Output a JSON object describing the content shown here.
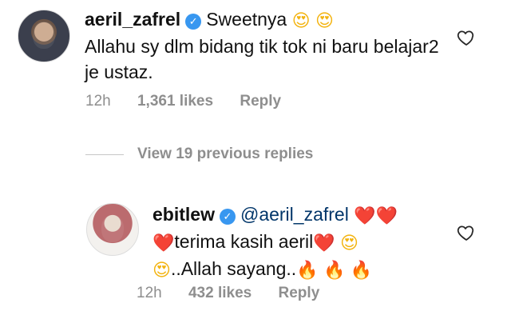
{
  "comments": [
    {
      "username": "aeril_zafrel",
      "lead_text": "Sweetnya",
      "emojis_line1": [
        "😍",
        "😍"
      ],
      "body": "Allahu sy dlm bidang tik tok ni baru belajar2 je ustaz.",
      "time": "12h",
      "likes": "1,361 likes",
      "reply": "Reply"
    },
    {
      "username": "ebitlew",
      "mention": "@aeril_zafrel",
      "emojis_line1": [
        "❤️",
        "❤️"
      ],
      "line2_lead": "❤️",
      "line2_text": "terima kasih aeril",
      "line2_emojis": [
        "❤️",
        "😍"
      ],
      "line3_lead": "😍",
      "line3_text": "..Allah sayang..",
      "line3_emojis": [
        "🔥",
        "🔥",
        "🔥"
      ],
      "time": "12h",
      "likes": "432 likes",
      "reply": "Reply"
    }
  ],
  "view_replies": "View 19 previous replies",
  "icons": {
    "verified": "verified-badge-icon",
    "like": "heart-outline-icon"
  },
  "colors": {
    "verified": "#3897f0",
    "meta": "#8e8e8e",
    "mention": "#003569"
  }
}
